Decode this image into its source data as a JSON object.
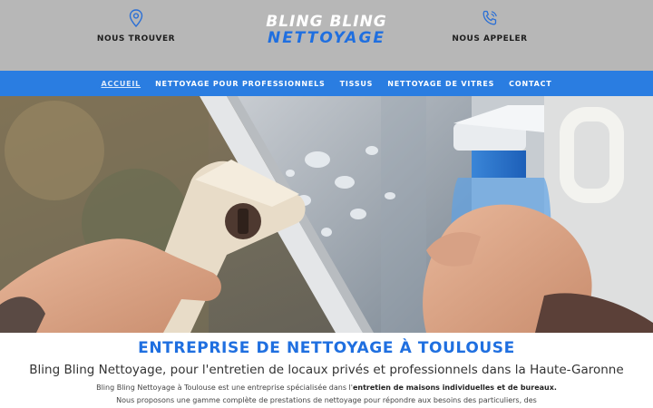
{
  "colors": {
    "header_bg": "#b7b7b7",
    "nav_bg": "#2a7de1",
    "accent": "#1f6fe0"
  },
  "header": {
    "left": {
      "icon": "map-pin-icon",
      "label": "NOUS TROUVER"
    },
    "logo": {
      "line1": "BLING BLING",
      "line2": "NETTOYAGE"
    },
    "right": {
      "icon": "phone-icon",
      "label": "NOUS APPELER"
    }
  },
  "nav": {
    "items": [
      {
        "label": "ACCUEIL",
        "active": true
      },
      {
        "label": "NETTOYAGE POUR PROFESSIONNELS"
      },
      {
        "label": "TISSUS"
      },
      {
        "label": "NETTOYAGE DE VITRES"
      },
      {
        "label": "CONTACT"
      }
    ]
  },
  "main": {
    "headline": "ENTREPRISE DE NETTOYAGE À TOULOUSE",
    "subheadline": "Bling Bling Nettoyage, pour l'entretien de locaux privés et professionnels dans la Haute-Garonne",
    "description_1_prefix": "Bling Bling Nettoyage à Toulouse est une entreprise spécialisée dans l'",
    "description_1_bold": "entretien de maisons individuelles et de bureaux.",
    "description_2": "Nous proposons une gamme complète de prestations de nettoyage pour répondre aux besoins des particuliers, des"
  }
}
